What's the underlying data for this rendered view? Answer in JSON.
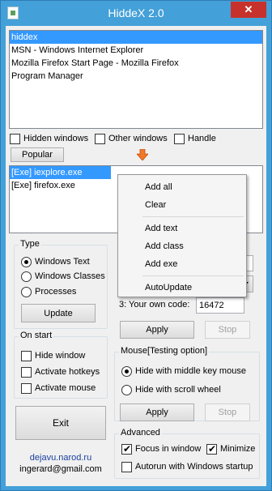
{
  "window": {
    "title": "HiddeX 2.0",
    "close_symbol": "✕"
  },
  "windows_list": [
    "hiddex",
    "MSN - Windows Internet Explorer",
    "Mozilla Firefox Start Page - Mozilla Firefox",
    "Program Manager"
  ],
  "filters": {
    "hidden_windows": "Hidden windows",
    "other_windows": "Other windows",
    "handle": "Handle"
  },
  "popular_button": "Popular",
  "process_list": [
    "[Exe] iexplore.exe",
    "[Exe] firefox.exe"
  ],
  "context_menu": {
    "add_all": "Add all",
    "clear": "Clear",
    "add_text": "Add text",
    "add_class": "Add class",
    "add_exe": "Add exe",
    "autoupdate": "AutoUpdate"
  },
  "type_group": {
    "label": "Type",
    "options": [
      "Windows Text",
      "Windows Classes",
      "Processes"
    ],
    "update": "Update"
  },
  "on_start_group": {
    "label": "On start",
    "hide_window": "Hide window",
    "activate_hotkeys": "Activate hotkeys",
    "activate_mouse": "Activate mouse"
  },
  "exit_button": "Exit",
  "footer": {
    "site": "dejavu.narod.ru",
    "email": "ingerard@gmail.com"
  },
  "code_row": {
    "label": "3:  Your own code:",
    "value": "16472"
  },
  "apply_label": "Apply",
  "stop_label": "Stop",
  "mouse_group": {
    "label": "Mouse[Testing option]",
    "middle_key": "Hide with middle key mouse",
    "scroll_wheel": "Hide with scroll wheel"
  },
  "advanced_group": {
    "label": "Advanced",
    "focus_in_window": "Focus in window",
    "minimize": "Minimize",
    "autorun": "Autorun with Windows startup"
  },
  "colors": {
    "titlebar": "#44a0d8",
    "selection": "#3399ff",
    "close": "#c7312b",
    "arrow": "#f07828"
  }
}
